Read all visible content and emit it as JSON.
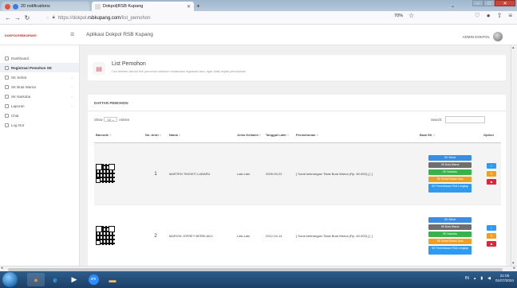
{
  "browser": {
    "tabs": [
      {
        "label": "20 notifications",
        "active": false
      },
      {
        "label": "Dokpol|RSB Kupang",
        "active": true
      }
    ],
    "new_tab_glyph": "+",
    "url_prefix": "https://dokpol.",
    "url_domain": "rsbkupang.com",
    "url_path": "/list_pemohon",
    "zoom": "70%"
  },
  "app": {
    "logo_text": "DOKPOLRSBKUPANG",
    "title": "Aplikasi Dokpol RSB Kupang",
    "user_name": "ADMIN DOKPOL"
  },
  "sidebar": {
    "items": [
      {
        "label": "Dashboard",
        "chevron": false,
        "active": false
      },
      {
        "label": "Registrasi Pemohon SK",
        "chevron": false,
        "active": true
      },
      {
        "label": "SK Sehat",
        "chevron": true,
        "active": false
      },
      {
        "label": "SK Buta Warna",
        "chevron": true,
        "active": false
      },
      {
        "label": "SK Narkoba",
        "chevron": true,
        "active": false
      },
      {
        "label": "Laporan",
        "chevron": true,
        "active": false
      },
      {
        "label": "Chat",
        "chevron": false,
        "active": false
      },
      {
        "label": "Log Out",
        "chevron": false,
        "active": false
      }
    ]
  },
  "page": {
    "title": "List Pemohon",
    "subtitle": "Cek terlebih dahulu NIK pemohon sebelum melakukan registrasi baru, agar tidak terjadi pendobelan"
  },
  "card": {
    "title": "DAFTAR PEMOHON",
    "show_label": "Show",
    "show_value": "10",
    "entries_label": "entries",
    "search_label": "Search:",
    "search_value": ""
  },
  "table": {
    "columns": [
      "Barcode",
      "No. Antri",
      "Nama",
      "Jenis Kelamin",
      "Tanggal Lahir",
      "Permohonan",
      "Buat SK",
      "Option"
    ],
    "rows": [
      {
        "no": "1",
        "nama": "MARTEN TIMOKTI LUBARU",
        "jk": "Laki-Laki",
        "tgl": "2009-09-22",
        "permohonan": "[ Surat keterangan Tidak Buta Warna (Rp. 60.000) ] [ ]"
      },
      {
        "no": "2",
        "nama": "MARVIN JOFREY BERELAKU",
        "jk": "Laki-Laki",
        "tgl": "2012-04-14",
        "permohonan": "[ Surat keterangan Tidak Buta Warna (Rp. 60.000) ] [ ]"
      }
    ],
    "sk_buttons": [
      "SK Sehat",
      "SK Buta Warna",
      "SK Narkoba",
      "SK Sehat Rohani Jiwa",
      "SK Pemeriksaan Fisik Lengkap"
    ]
  },
  "taskbar": {
    "time": "21:05",
    "date": "01/07/2024",
    "lang": "IN"
  },
  "colors": {
    "accent_blue": "#3a8de0",
    "gray": "#6f6f6f",
    "green": "#38b349",
    "orange": "#f0a020",
    "danger": "#e0243c"
  }
}
